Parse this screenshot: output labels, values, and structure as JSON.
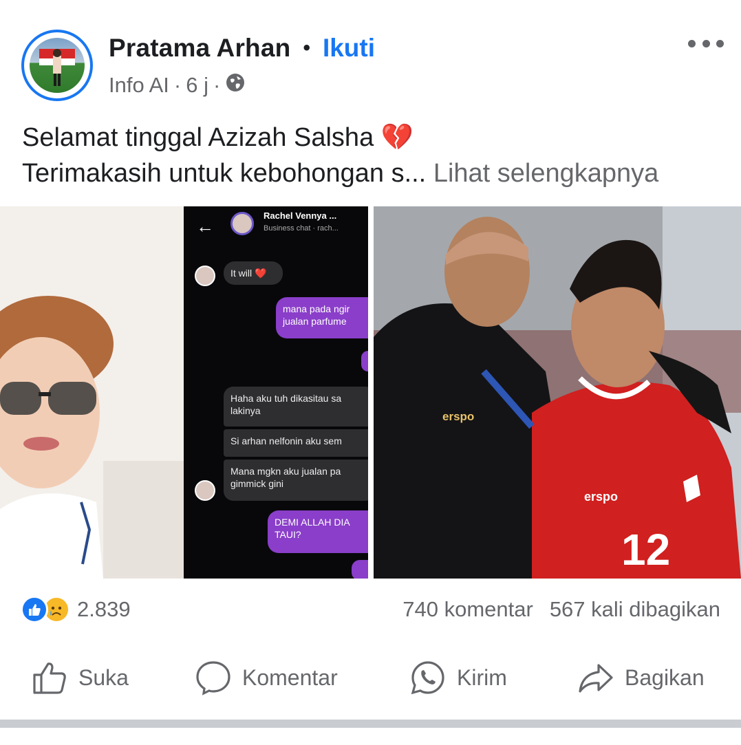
{
  "post": {
    "author": "Pratama Arhan",
    "separator": "•",
    "follow_label": "Ikuti",
    "source": "Info AI",
    "time": "6 j",
    "dot": "·",
    "caption_line1": "Selamat tinggal Azizah Salsha 💔",
    "caption_line2": "Terimakasih untuk kebohongan s...",
    "see_more": "Lihat selengkapnya"
  },
  "chat": {
    "title": "Rachel Vennya ...",
    "subtitle": "Business chat · rach...",
    "messages": [
      {
        "from": "them",
        "text": "It will ❤️"
      },
      {
        "from": "me",
        "text": "mana pada ngir\njualan parfume"
      },
      {
        "from": "them",
        "text": "Haha aku tuh dikasitau sa\nlakinya"
      },
      {
        "from": "them",
        "text": "Si arhan nelfonin aku sem"
      },
      {
        "from": "them",
        "text": "Mana mgkn aku jualan pa\ngimmick gini"
      },
      {
        "from": "me",
        "text": "DEMI ALLAH DIA\nTAUI?"
      }
    ]
  },
  "photo": {
    "brand_text": "erspo",
    "jersey_number": "12"
  },
  "stats": {
    "reaction_count": "2.839",
    "comments": "740 komentar",
    "shares": "567 kali dibagikan"
  },
  "actions": {
    "like": "Suka",
    "comment": "Komentar",
    "send": "Kirim",
    "share": "Bagikan"
  },
  "colors": {
    "accent": "#1877f2",
    "secondary_text": "#65676b",
    "chat_outgoing": "#8a3ec9"
  }
}
